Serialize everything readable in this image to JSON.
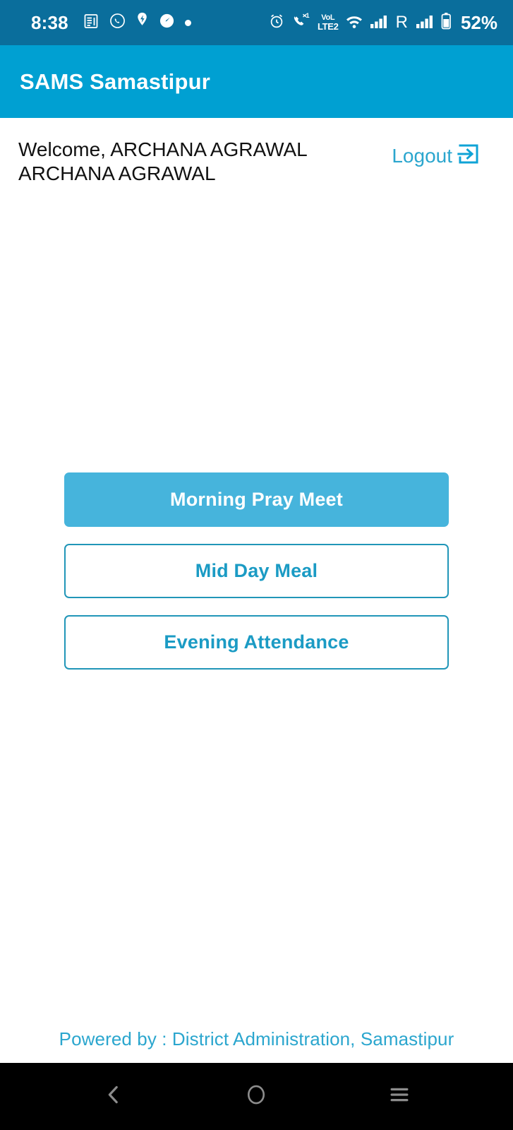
{
  "status_bar": {
    "time": "8:38",
    "battery_percent": "52%",
    "roaming_letter": "R",
    "volte_line1": "VoL",
    "volte_line2": "LTE2",
    "missed_call_count": "1",
    "background_color": "#0A6E9C",
    "left_icons": [
      "news-document-icon",
      "whatsapp-icon",
      "location-pin-icon",
      "speedometer-icon",
      "dot-icon"
    ],
    "right_icons": [
      "alarm-clock-icon",
      "missed-call-icon",
      "volte-icon",
      "wifi-icon",
      "signal-bars-icon",
      "roaming-icon",
      "signal-bars-2-icon",
      "battery-icon"
    ]
  },
  "app_bar": {
    "title": "SAMS Samastipur",
    "background_color": "#00A0D2",
    "text_color": "#FFFFFF"
  },
  "header": {
    "welcome_text": "Welcome, ARCHANA AGRAWAL ARCHANA AGRAWAL",
    "logout_label": "Logout",
    "logout_icon": "logout-exit-icon",
    "logout_color": "#2BA6CE"
  },
  "menu": {
    "buttons": [
      {
        "label": "Morning Pray Meet",
        "style": "filled",
        "fill": "#46B4DC",
        "text_color": "#FFFFFF"
      },
      {
        "label": "Mid Day Meal",
        "style": "outlined",
        "border": "#2196B8",
        "text_color": "#1B9BC4"
      },
      {
        "label": "Evening Attendance",
        "style": "outlined",
        "border": "#2196B8",
        "text_color": "#1B9BC4"
      }
    ]
  },
  "footer": {
    "text": "Powered by  : District Administration, Samastipur",
    "color": "#2BA6CE"
  },
  "nav_bar": {
    "background_color": "#000000",
    "icon_color": "#8C8C8C",
    "buttons": [
      {
        "name": "back",
        "icon": "chevron-left-icon"
      },
      {
        "name": "home",
        "icon": "circle-icon"
      },
      {
        "name": "recents",
        "icon": "hamburger-icon"
      }
    ]
  }
}
